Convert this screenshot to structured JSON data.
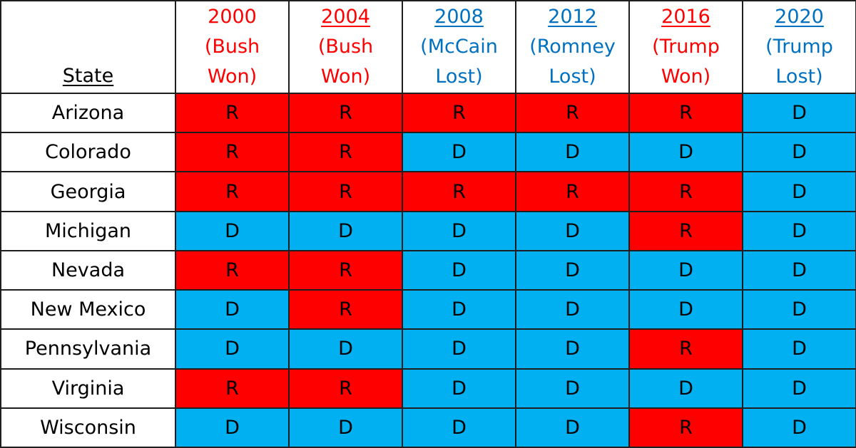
{
  "table": {
    "state_header": "State",
    "colors": {
      "R": "#ff0000",
      "D": "#00b0f0",
      "header_won": "#ff0000",
      "header_lost": "#0070c0"
    },
    "columns": [
      {
        "year": "2000",
        "line2": "(Bush",
        "line3": "Won)",
        "result": "won",
        "underlined": false
      },
      {
        "year": "2004",
        "line2": "(Bush",
        "line3": "Won)",
        "result": "won",
        "underlined": true
      },
      {
        "year": "2008",
        "line2": "(McCain",
        "line3": "Lost)",
        "result": "lost",
        "underlined": true
      },
      {
        "year": "2012",
        "line2": "(Romney",
        "line3": "Lost)",
        "result": "lost",
        "underlined": true
      },
      {
        "year": "2016",
        "line2": "(Trump",
        "line3": "Won)",
        "result": "won",
        "underlined": true
      },
      {
        "year": "2020",
        "line2": "(Trump",
        "line3": "Lost)",
        "result": "lost",
        "underlined": true
      }
    ],
    "rows": [
      {
        "state": "Arizona",
        "values": [
          "R",
          "R",
          "R",
          "R",
          "R",
          "D"
        ]
      },
      {
        "state": "Colorado",
        "values": [
          "R",
          "R",
          "D",
          "D",
          "D",
          "D"
        ]
      },
      {
        "state": "Georgia",
        "values": [
          "R",
          "R",
          "R",
          "R",
          "R",
          "D"
        ]
      },
      {
        "state": "Michigan",
        "values": [
          "D",
          "D",
          "D",
          "D",
          "R",
          "D"
        ]
      },
      {
        "state": "Nevada",
        "values": [
          "R",
          "R",
          "D",
          "D",
          "D",
          "D"
        ]
      },
      {
        "state": "New Mexico",
        "values": [
          "D",
          "R",
          "D",
          "D",
          "D",
          "D"
        ]
      },
      {
        "state": "Pennsylvania",
        "values": [
          "D",
          "D",
          "D",
          "D",
          "R",
          "D"
        ]
      },
      {
        "state": "Virginia",
        "values": [
          "R",
          "R",
          "D",
          "D",
          "D",
          "D"
        ]
      },
      {
        "state": "Wisconsin",
        "values": [
          "D",
          "D",
          "D",
          "D",
          "R",
          "D"
        ]
      }
    ]
  }
}
